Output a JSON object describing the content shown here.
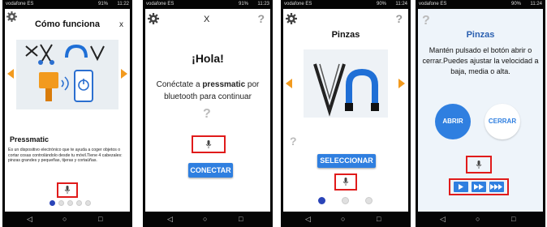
{
  "status": {
    "s1": {
      "carrier": "vodafone ES",
      "signal": "91%",
      "time": "11:22"
    },
    "s2": {
      "carrier": "vodafone ES",
      "signal": "91%",
      "time": "11:23"
    },
    "s3": {
      "carrier": "vodafone ES",
      "signal": "90%",
      "time": "11:24"
    },
    "s4": {
      "carrier": "vodafone ES",
      "signal": "90%",
      "time": "11:24"
    }
  },
  "screen1": {
    "title": "Cómo funciona",
    "close": "x",
    "heading": "Pressmatic",
    "description": "Es un dispositivo electrónico que te ayuda a coger objetos o cortar cosas controlándolo desde tu móvil.Tiene 4 cabezales: pinzas grandes y pequeñas, tijeras y cortaúñas.",
    "page_dots": 5,
    "active_dot": 1
  },
  "screen2": {
    "close": "X",
    "help": "?",
    "greeting": "¡Hola!",
    "connect_prefix": "Conéctate a ",
    "connect_brand": "pressmatic",
    "connect_suffix": " por bluetooth para continuar",
    "question": "?",
    "connect_button": "CONECTAR"
  },
  "screen3": {
    "help": "?",
    "title": "Pinzas",
    "question": "?",
    "select_button": "SELECCIONAR",
    "page_dots": 3,
    "active_dot": 1
  },
  "screen4": {
    "help": "?",
    "title": "Pinzas",
    "instructions": "Mantén pulsado el botón abrir o cerrar.Puedes ajustar la velocidad a baja, media o alta.",
    "open_button": "ABRIR",
    "close_button": "CERRAR"
  },
  "nav": {
    "back": "◁",
    "home": "○",
    "recent": "□"
  },
  "colors": {
    "accent_orange": "#f29a1e",
    "button_blue": "#2f7fe0",
    "dot_blue": "#2a44b8",
    "highlight_red": "#e01b1b",
    "tool_blue": "#1f6fd6"
  }
}
